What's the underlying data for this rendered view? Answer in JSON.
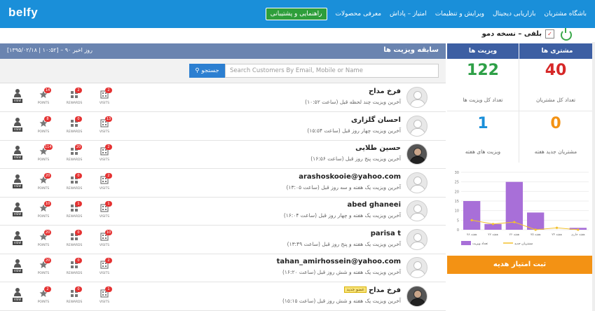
{
  "app": {
    "logo": "belfy",
    "brand": "بلفی – نسخه دمو"
  },
  "nav": [
    {
      "label": "باشگاه مشتریان",
      "active": false
    },
    {
      "label": "بازاریابی دیجیتال",
      "active": false
    },
    {
      "label": "ویرایش و تنظیمات",
      "active": false
    },
    {
      "label": "امتیاز – پاداش",
      "active": false
    },
    {
      "label": "معرفی محصولات",
      "active": false
    },
    {
      "label": "راهنمایی و پشتیبانی",
      "active": true
    }
  ],
  "panel": {
    "title": "سابقه ویزیت ها",
    "date": "[۱۳۹۵/۰۲/۱۸ | ۱۰:۵۲] – ۹۰ روز اخیر",
    "search_placeholder": "Search Customers By Email, Mobile or Name",
    "search_button": "جستجو"
  },
  "stat_labels": {
    "points": "POINTS",
    "rewards": "REWARDS",
    "visits": "VISITS",
    "view": "VIEW"
  },
  "customers": [
    {
      "name": "فرخ مداح",
      "last": "آخرین ویزیت چند لحظه قبل (ساعت ۱۰:۵۲)",
      "points": "14",
      "rewards": "2",
      "visits": "2",
      "photo": false,
      "tag": ""
    },
    {
      "name": "احسان گلزاری",
      "last": "آخرین ویزیت چهار روز قبل (ساعت ۱۵:۵۴)",
      "points": "8",
      "rewards": "0",
      "visits": "13",
      "photo": false,
      "tag": ""
    },
    {
      "name": "حسین طلایی",
      "last": "آخرین ویزیت پنج روز قبل (ساعت ۱۶:۵۶)",
      "points": "114",
      "rewards": "20",
      "visits": "2",
      "photo": true,
      "tag": ""
    },
    {
      "name": "arashoskooie@yahoo.com",
      "last": "آخرین ویزیت یک هفته و سه روز قبل (ساعت ۱۳:۰۵)",
      "points": "20",
      "rewards": "0",
      "visits": "2",
      "photo": false,
      "tag": ""
    },
    {
      "name": "abed ghaneei",
      "last": "آخرین ویزیت یک هفته و چهار روز قبل (ساعت ۱۶:۰۴)",
      "points": "10",
      "rewards": "1",
      "visits": "1",
      "photo": false,
      "tag": ""
    },
    {
      "name": "parisa t",
      "last": "آخرین ویزیت یک هفته و پنج روز قبل (ساعت ۱۳:۴۹)",
      "points": "20",
      "rewards": "0",
      "visits": "10",
      "photo": false,
      "tag": ""
    },
    {
      "name": "tahan_amirhossein@yahoo.com",
      "last": "آخرین ویزیت یک هفته و شش روز قبل (ساعت ۱۶:۲۰)",
      "points": "20",
      "rewards": "0",
      "visits": "2",
      "photo": false,
      "tag": ""
    },
    {
      "name": "فرخ مداح",
      "last": "آخرین ویزیت یک هفته و شش روز قبل (ساعت ۱۵:۱۵)",
      "points": "2",
      "rewards": "0",
      "visits": "1",
      "photo": true,
      "tag": "عضو جدید"
    }
  ],
  "kpi": {
    "visits_header": "ویزیت ها",
    "customers_header": "مشتری ها",
    "total_visits": "122",
    "total_visits_label": "تعداد کل ویزیت ها",
    "total_customers": "40",
    "total_customers_label": "تعداد کل مشتریان",
    "week_visits": "1",
    "week_visits_label": "ویزیت های هفته",
    "week_new_customers": "0",
    "week_new_customers_label": "مشتریان جدید هفته"
  },
  "colors": {
    "visits_kpi": "#2ea047",
    "customers_kpi": "#d62828",
    "week_visits_kpi": "#1a8fd9",
    "week_new_kpi": "#f39214",
    "bar": "#a86fd8",
    "line": "#f2c12e"
  },
  "chart_data": {
    "type": "bar",
    "categories": [
      "هفته ۷۸",
      "هفته ۷۷",
      "هفته ۷۶",
      "هفته ۷۵",
      "هفته ۷۴",
      "هفته جاری"
    ],
    "series": [
      {
        "name": "تعداد ویزیت",
        "type": "bar",
        "values": [
          15,
          3,
          25,
          9,
          0,
          1
        ]
      },
      {
        "name": "مشتریان جدید",
        "type": "line",
        "values": [
          5,
          3,
          4,
          0,
          1,
          0
        ]
      }
    ],
    "yticks": [
      "0",
      "5",
      "10",
      "15",
      "20",
      "25",
      "30"
    ],
    "ylim": [
      0,
      30
    ]
  },
  "gift_button": "ثبت امتیاز هدیه"
}
